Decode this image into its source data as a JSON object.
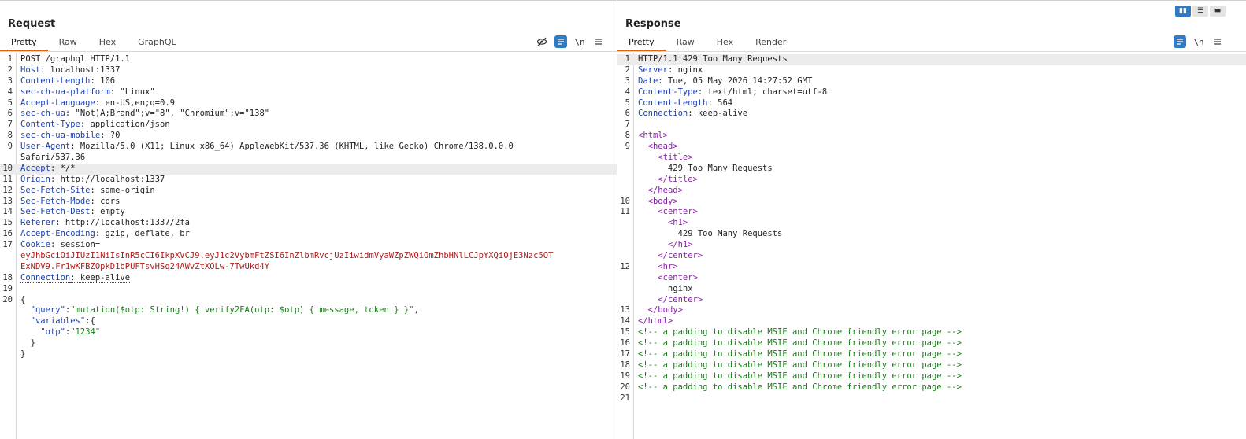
{
  "layout_buttons": [
    "▮▮",
    "☰",
    "▬"
  ],
  "request": {
    "title": "Request",
    "tabs": [
      "Pretty",
      "Raw",
      "Hex",
      "GraphQL"
    ],
    "tools": [
      "hide-icon",
      "wrap-icon",
      "newline-icon",
      "menu-icon"
    ],
    "tool_glyphs": [
      "👁",
      "≡",
      "\\n",
      "≡"
    ],
    "lines": [
      {
        "n": "1",
        "k": "",
        "v": "POST /graphql HTTP/1.1"
      },
      {
        "n": "2",
        "k": "Host",
        "v": ": localhost:1337"
      },
      {
        "n": "3",
        "k": "Content-Length",
        "v": ": 106"
      },
      {
        "n": "4",
        "k": "sec-ch-ua-platform",
        "v": ": \"Linux\""
      },
      {
        "n": "5",
        "k": "Accept-Language",
        "v": ": en-US,en;q=0.9"
      },
      {
        "n": "6",
        "k": "sec-ch-ua",
        "v": ": \"Not)A;Brand\";v=\"8\", \"Chromium\";v=\"138\""
      },
      {
        "n": "7",
        "k": "Content-Type",
        "v": ": application/json"
      },
      {
        "n": "8",
        "k": "sec-ch-ua-mobile",
        "v": ": ?0"
      },
      {
        "n": "9",
        "k": "User-Agent",
        "v": ": Mozilla/5.0 (X11; Linux x86_64) AppleWebKit/537.36 (KHTML, like Gecko) Chrome/138.0.0.0"
      },
      {
        "n": "",
        "k": "",
        "v": "Safari/537.36"
      },
      {
        "n": "10",
        "k": "Accept",
        "v": ": */*",
        "hl": true
      },
      {
        "n": "11",
        "k": "Origin",
        "v": ": http://localhost:1337"
      },
      {
        "n": "12",
        "k": "Sec-Fetch-Site",
        "v": ": same-origin"
      },
      {
        "n": "13",
        "k": "Sec-Fetch-Mode",
        "v": ": cors"
      },
      {
        "n": "14",
        "k": "Sec-Fetch-Dest",
        "v": ": empty"
      },
      {
        "n": "15",
        "k": "Referer",
        "v": ": http://localhost:1337/2fa"
      },
      {
        "n": "16",
        "k": "Accept-Encoding",
        "v": ": gzip, deflate, br"
      },
      {
        "n": "17",
        "k": "Cookie",
        "v": ": session="
      },
      {
        "n": "",
        "k": "",
        "red": "eyJhbGciOiJIUzI1NiIsInR5cCI6IkpXVCJ9.eyJ1c2VybmFtZSI6InZlbmRvcjUzIiwidmVyaWZpZWQiOmZhbHNlLCJpYXQiOjE3Nzc5OT"
      },
      {
        "n": "",
        "k": "",
        "red": "ExNDV9.Fr1wKFBZOpkD1bPUFTsvHSq24AWvZtXOLw-7TwUkd4Y"
      },
      {
        "n": "18",
        "k": "Connection",
        "v": ": keep-alive",
        "dotted": true
      },
      {
        "n": "19",
        "k": "",
        "v": ""
      },
      {
        "n": "20",
        "k": "",
        "v": "{"
      },
      {
        "n": "",
        "json_key": "\"query\"",
        "json_sep": ":",
        "json_val": "\"mutation($otp: String!) { verify2FA(otp: $otp) { message, token } }\"",
        "json_tail": ","
      },
      {
        "n": "",
        "json_key": "\"variables\"",
        "json_sep": ":",
        "json_val": "",
        "json_tail": "{"
      },
      {
        "n": "",
        "indent": 2,
        "json_key": "\"otp\"",
        "json_sep": ":",
        "json_val": "\"1234\"",
        "json_tail": ""
      },
      {
        "n": "",
        "k": "",
        "v": "  }"
      },
      {
        "n": "",
        "k": "",
        "v": "}"
      }
    ]
  },
  "response": {
    "title": "Response",
    "tabs": [
      "Pretty",
      "Raw",
      "Hex",
      "Render"
    ],
    "tools": [
      "wrap-icon",
      "newline-icon",
      "menu-icon"
    ],
    "tool_glyphs": [
      "≡",
      "\\n",
      "≡"
    ],
    "lines": [
      {
        "n": "1",
        "k": "",
        "v": "HTTP/1.1 429 Too Many Requests",
        "hl": true
      },
      {
        "n": "2",
        "k": "Server",
        "v": ": nginx"
      },
      {
        "n": "3",
        "k": "Date",
        "v": ": Tue, 05 May 2026 14:27:52 GMT"
      },
      {
        "n": "4",
        "k": "Content-Type",
        "v": ": text/html; charset=utf-8"
      },
      {
        "n": "5",
        "k": "Content-Length",
        "v": ": 564"
      },
      {
        "n": "6",
        "k": "Connection",
        "v": ": keep-alive"
      },
      {
        "n": "7",
        "k": "",
        "v": ""
      },
      {
        "n": "8",
        "tag": "<html>",
        "pre": ""
      },
      {
        "n": "9",
        "tag": "<head>",
        "pre": "  "
      },
      {
        "n": "",
        "tag": "<title>",
        "pre": "    "
      },
      {
        "n": "",
        "k": "",
        "v": "      429 Too Many Requests"
      },
      {
        "n": "",
        "tag": "</title>",
        "pre": "    "
      },
      {
        "n": "",
        "tag": "</head>",
        "pre": "  "
      },
      {
        "n": "10",
        "tag": "<body>",
        "pre": "  "
      },
      {
        "n": "11",
        "tag": "<center>",
        "pre": "    "
      },
      {
        "n": "",
        "tag": "<h1>",
        "pre": "      "
      },
      {
        "n": "",
        "k": "",
        "v": "        429 Too Many Requests"
      },
      {
        "n": "",
        "tag": "</h1>",
        "pre": "      "
      },
      {
        "n": "",
        "tag": "</center>",
        "pre": "    "
      },
      {
        "n": "12",
        "tag": "<hr>",
        "pre": "    "
      },
      {
        "n": "",
        "tag": "<center>",
        "pre": "    "
      },
      {
        "n": "",
        "k": "",
        "v": "      nginx"
      },
      {
        "n": "",
        "tag": "</center>",
        "pre": "    "
      },
      {
        "n": "13",
        "tag": "</body>",
        "pre": "  "
      },
      {
        "n": "14",
        "tag": "</html>",
        "pre": ""
      },
      {
        "n": "15",
        "cmt": "<!-- a padding to disable MSIE and Chrome friendly error page -->"
      },
      {
        "n": "16",
        "cmt": "<!-- a padding to disable MSIE and Chrome friendly error page -->"
      },
      {
        "n": "17",
        "cmt": "<!-- a padding to disable MSIE and Chrome friendly error page -->"
      },
      {
        "n": "18",
        "cmt": "<!-- a padding to disable MSIE and Chrome friendly error page -->"
      },
      {
        "n": "19",
        "cmt": "<!-- a padding to disable MSIE and Chrome friendly error page -->"
      },
      {
        "n": "20",
        "cmt": "<!-- a padding to disable MSIE and Chrome friendly error page -->"
      },
      {
        "n": "21",
        "k": "",
        "v": ""
      }
    ]
  }
}
